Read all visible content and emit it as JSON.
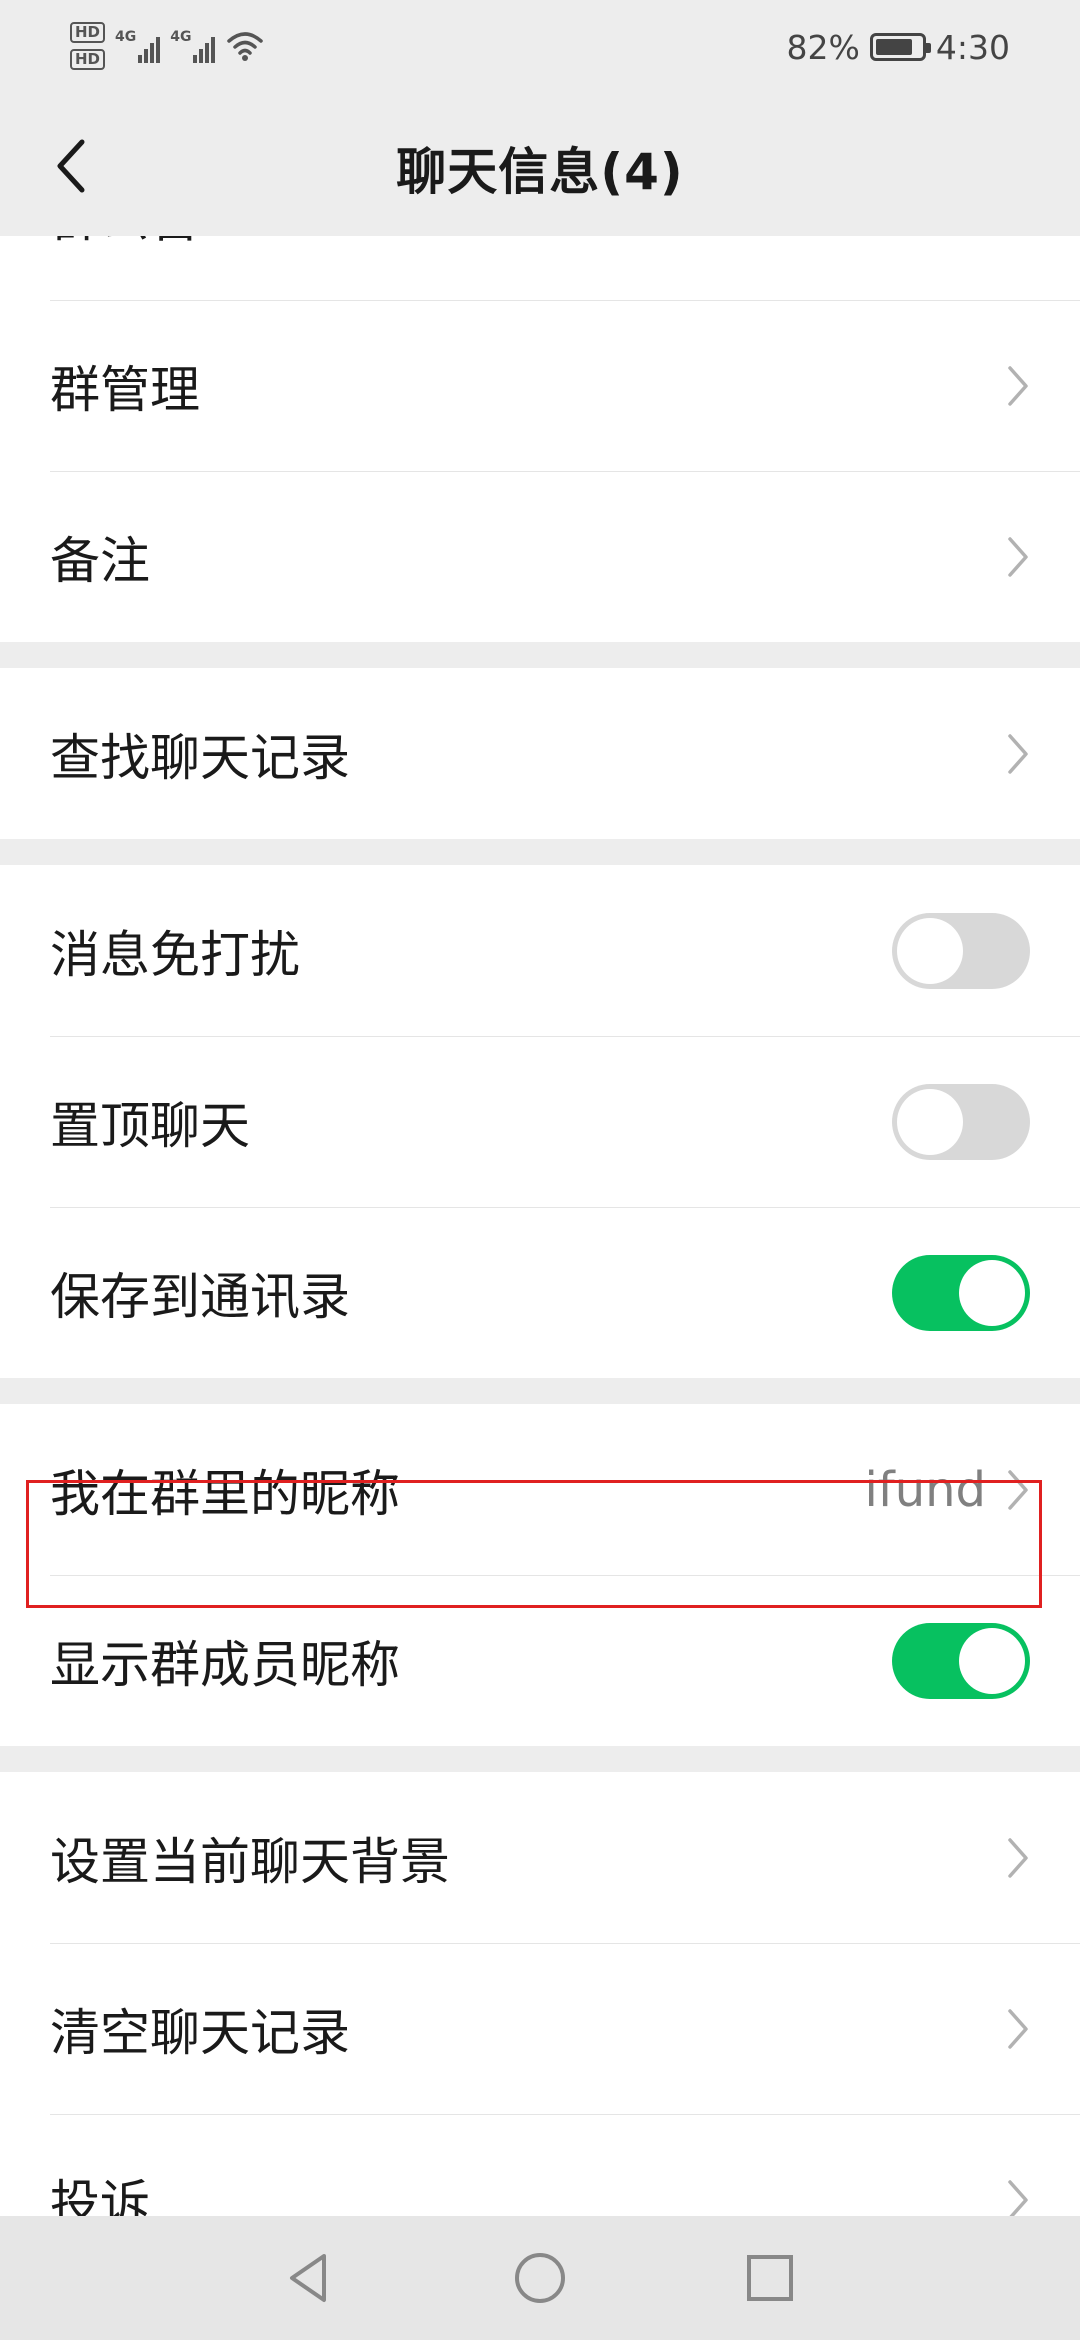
{
  "status_bar": {
    "hd1": "HD",
    "hd2": "HD",
    "sim1_net": "4G",
    "sim2_net": "4G",
    "battery_percent": "82%",
    "battery_level": 0.82,
    "time": "4:30"
  },
  "header": {
    "title": "聊天信息(4)",
    "back_icon": "chevron-left-icon"
  },
  "groups": [
    {
      "rows": [
        {
          "label": "群公告",
          "control": "chevron"
        },
        {
          "label": "群管理",
          "control": "chevron"
        },
        {
          "label": "备注",
          "control": "chevron"
        }
      ]
    },
    {
      "rows": [
        {
          "label": "查找聊天记录",
          "control": "chevron"
        }
      ]
    },
    {
      "rows": [
        {
          "label": "消息免打扰",
          "control": "toggle",
          "on": false
        },
        {
          "label": "置顶聊天",
          "control": "toggle",
          "on": false
        },
        {
          "label": "保存到通讯录",
          "control": "toggle",
          "on": true,
          "highlighted": true
        }
      ]
    },
    {
      "rows": [
        {
          "label": "我在群里的昵称",
          "control": "chevron",
          "value": "ifund"
        },
        {
          "label": "显示群成员昵称",
          "control": "toggle",
          "on": true
        }
      ]
    },
    {
      "rows": [
        {
          "label": "设置当前聊天背景",
          "control": "chevron"
        },
        {
          "label": "清空聊天记录",
          "control": "chevron"
        },
        {
          "label": "投诉",
          "control": "chevron"
        }
      ]
    }
  ],
  "colors": {
    "toggle_on": "#07c160",
    "toggle_off": "#d8d8d8",
    "highlight_border": "#e02020",
    "page_background": "#ededed"
  },
  "nav_bar": {
    "back_icon": "triangle-back-icon",
    "home_icon": "circle-home-icon",
    "recents_icon": "square-recents-icon"
  }
}
